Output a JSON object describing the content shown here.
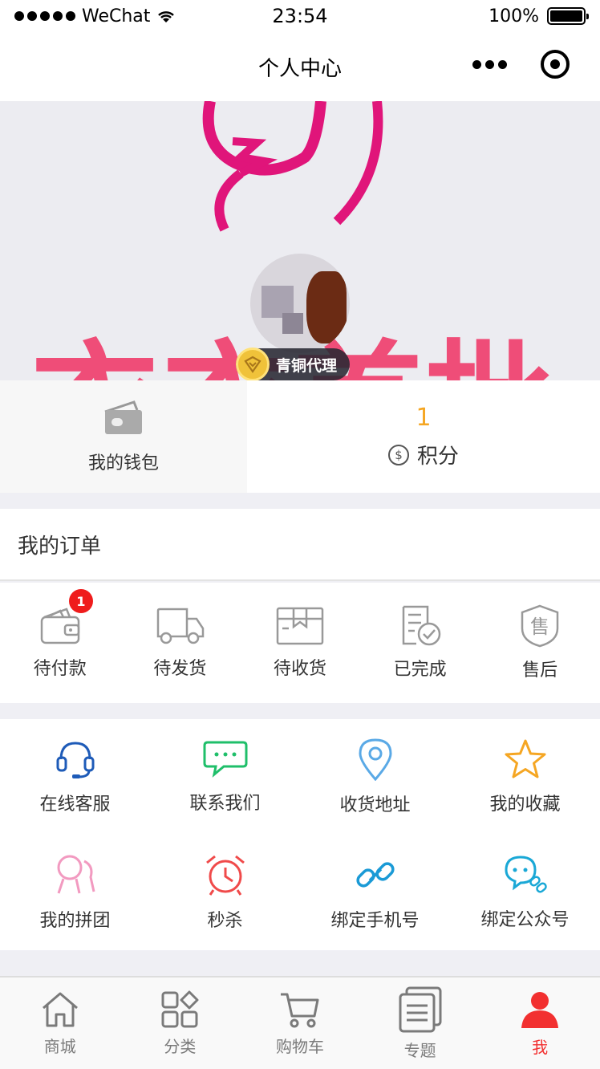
{
  "status_bar": {
    "carrier": "WeChat",
    "time": "23:54",
    "battery": "100%"
  },
  "nav": {
    "title": "个人中心"
  },
  "banner": {
    "brand_text": "衣衣首批",
    "member_level": "青铜代理"
  },
  "stats": {
    "wallet_label": "我的钱包",
    "points_value": "1",
    "points_label": "积分"
  },
  "orders": {
    "title": "我的订单",
    "items": [
      {
        "label": "待付款",
        "icon": "wallet-icon",
        "badge": "1"
      },
      {
        "label": "待发货",
        "icon": "truck-icon"
      },
      {
        "label": "待收货",
        "icon": "package-icon"
      },
      {
        "label": "已完成",
        "icon": "completed-doc-icon"
      },
      {
        "label": "售后",
        "icon": "shield-icon"
      }
    ]
  },
  "services": [
    {
      "label": "在线客服",
      "icon": "headset-icon",
      "color": "#1e5bb8"
    },
    {
      "label": "联系我们",
      "icon": "chat-icon",
      "color": "#1fbf6a"
    },
    {
      "label": "收货地址",
      "icon": "location-icon",
      "color": "#5aa9e6"
    },
    {
      "label": "我的收藏",
      "icon": "star-icon",
      "color": "#f5a623"
    },
    {
      "label": "我的拼团",
      "icon": "group-icon",
      "color": "#f29ac0"
    },
    {
      "label": "秒杀",
      "icon": "alarm-clock-icon",
      "color": "#f04a4a"
    },
    {
      "label": "绑定手机号",
      "icon": "link-icon",
      "color": "#1a9ad6"
    },
    {
      "label": "绑定公众号",
      "icon": "wechat-bind-icon",
      "color": "#1aa8d6"
    }
  ],
  "tabbar": [
    {
      "label": "商城",
      "icon": "home-icon",
      "active": false
    },
    {
      "label": "分类",
      "icon": "category-icon",
      "active": false
    },
    {
      "label": "购物车",
      "icon": "cart-icon",
      "active": false
    },
    {
      "label": "专题",
      "icon": "topic-icon",
      "active": false
    },
    {
      "label": "我",
      "icon": "user-icon",
      "active": true
    }
  ]
}
